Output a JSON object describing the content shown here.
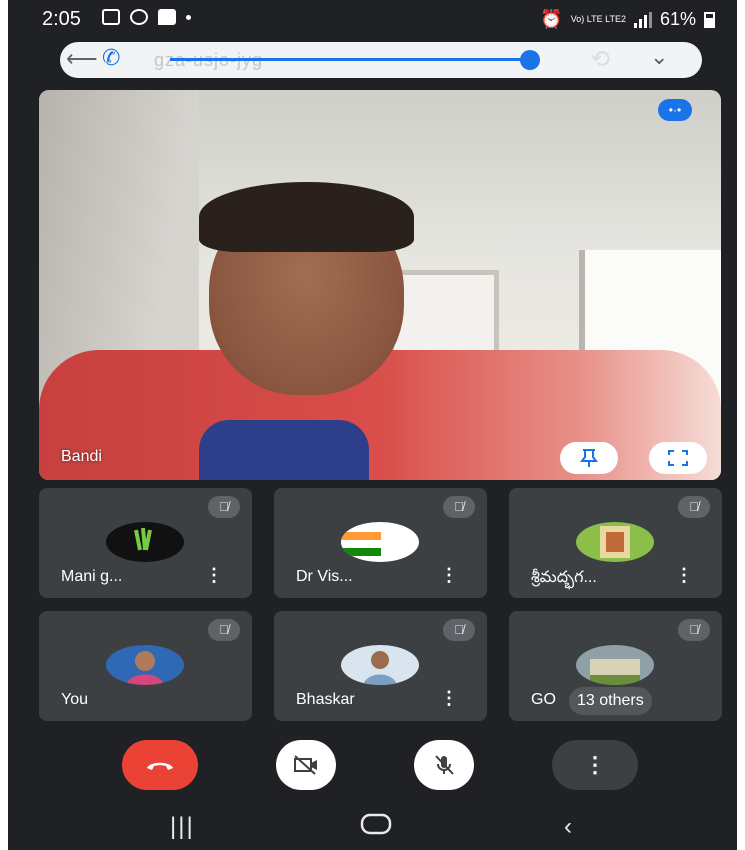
{
  "status_bar": {
    "time": "2:05",
    "network": "Vo) LTE LTE2",
    "battery": "61%"
  },
  "call_bar": {
    "meeting_code": "gza-usjo-jyg",
    "colors": {
      "accent": "#1a73e8",
      "bar": "#f1f3f4"
    }
  },
  "main_video": {
    "speaker_name": "Bandi",
    "people_icon": "people-icon",
    "pin_icon": "pin-icon",
    "fullscreen_icon": "fullscreen-icon"
  },
  "tiles": [
    {
      "name": "Mani g...",
      "avatar": "monster-energy-avatar",
      "muted": true
    },
    {
      "name": "Dr Vis...",
      "avatar": "flag-avatar",
      "muted": true
    },
    {
      "name": "శ్రీమద్భగ...",
      "avatar": "image-avatar",
      "muted": true
    },
    {
      "name": "You",
      "avatar": "photo-avatar",
      "muted": true
    },
    {
      "name": "Bhaskar",
      "avatar": "photo-avatar",
      "muted": true
    },
    {
      "name": "GO",
      "avatar": "building-avatar",
      "muted": true,
      "others": "13 others"
    }
  ],
  "controls": {
    "end_call": "phone-hangup-icon",
    "camera": "camera-off-icon",
    "mic": "mic-off-icon",
    "more": "more-vert-icon",
    "colors": {
      "end_call": "#ea4335",
      "toggle": "#ffffff",
      "more": "#3c4043"
    }
  },
  "nav_bar": {
    "recents": "recents-icon",
    "home": "home-icon",
    "back": "back-icon"
  }
}
